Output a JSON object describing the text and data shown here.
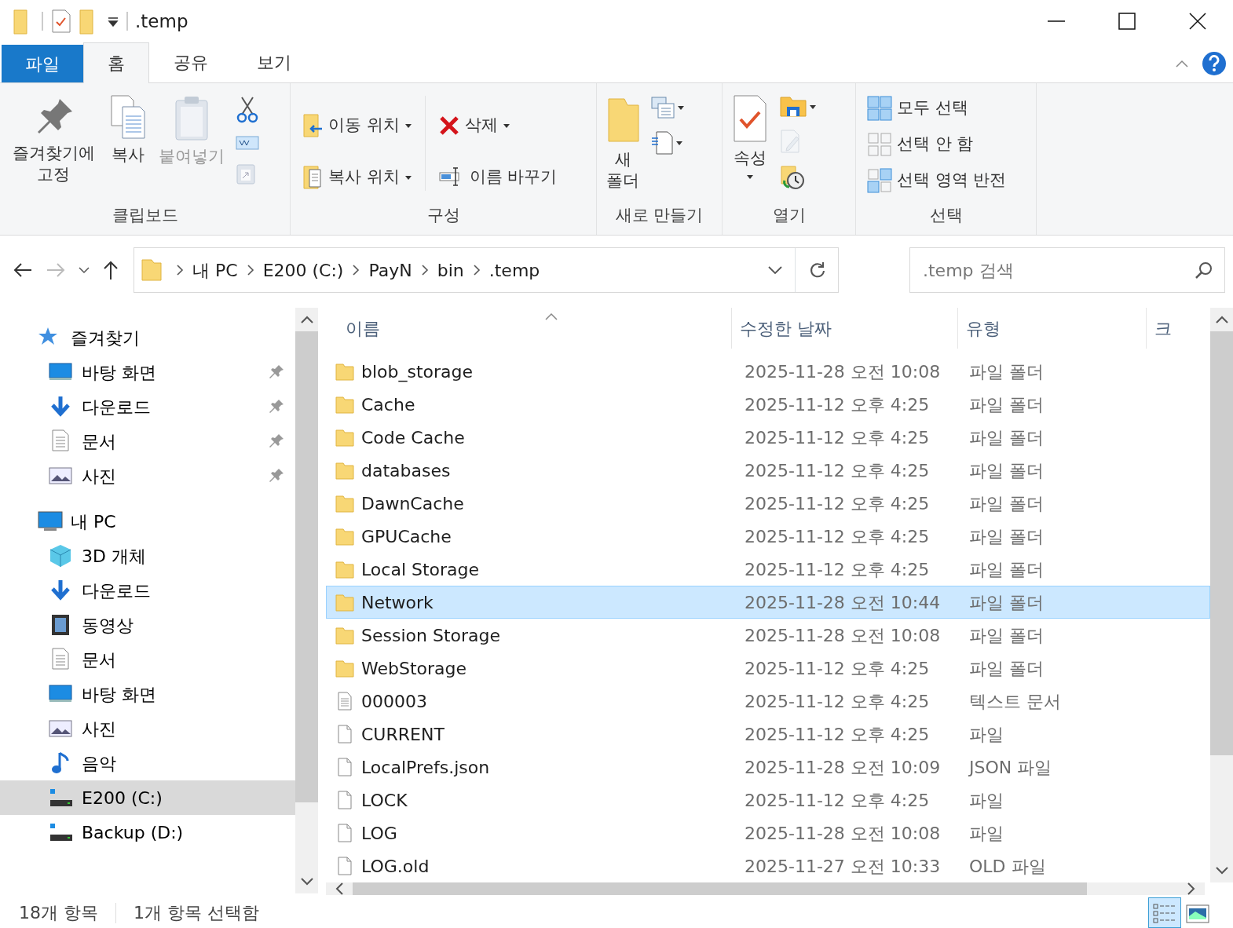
{
  "window": {
    "title": ".temp"
  },
  "ribbon": {
    "tabs": [
      {
        "label": "파일",
        "kind": "file",
        "selected": false
      },
      {
        "label": "홈",
        "kind": "tab",
        "selected": true
      },
      {
        "label": "공유",
        "kind": "tab",
        "selected": false
      },
      {
        "label": "보기",
        "kind": "tab",
        "selected": false
      }
    ],
    "groups": [
      {
        "label": "클립보드",
        "items": [
          {
            "kind": "large",
            "label": "즐겨찾기에 고정",
            "disabled": false,
            "dropdown": false
          },
          {
            "kind": "large",
            "label": "복사",
            "disabled": false,
            "dropdown": false
          },
          {
            "kind": "large",
            "label": "붙여넣기",
            "disabled": true,
            "dropdown": false
          },
          {
            "kind": "icon",
            "disabled": false,
            "dropdown": false
          },
          {
            "kind": "icon",
            "disabled": false,
            "dropdown": false
          },
          {
            "kind": "icon",
            "disabled": true,
            "dropdown": false
          }
        ]
      },
      {
        "label": "구성",
        "items": [
          {
            "kind": "small",
            "label": "이동 위치",
            "disabled": false,
            "dropdown": true
          },
          {
            "kind": "small",
            "label": "복사 위치",
            "disabled": false,
            "dropdown": true
          },
          {
            "kind": "small",
            "label": "삭제",
            "disabled": false,
            "dropdown": true
          },
          {
            "kind": "small",
            "label": "이름 바꾸기",
            "disabled": false,
            "dropdown": false
          }
        ]
      },
      {
        "label": "새로 만들기",
        "items": [
          {
            "kind": "large",
            "label": "새 폴더",
            "disabled": false,
            "dropdown": false
          },
          {
            "kind": "icon",
            "disabled": false,
            "dropdown": true
          },
          {
            "kind": "icon",
            "disabled": false,
            "dropdown": true
          }
        ]
      },
      {
        "label": "열기",
        "items": [
          {
            "kind": "large",
            "label": "속성",
            "disabled": false,
            "dropdown": true
          },
          {
            "kind": "icon",
            "disabled": false,
            "dropdown": true
          },
          {
            "kind": "icon",
            "disabled": true,
            "dropdown": false
          },
          {
            "kind": "icon",
            "disabled": false,
            "dropdown": false
          }
        ]
      },
      {
        "label": "선택",
        "items": [
          {
            "kind": "small",
            "label": "모두 선택",
            "disabled": false,
            "dropdown": false
          },
          {
            "kind": "small",
            "label": "선택 안 함",
            "disabled": false,
            "dropdown": false
          },
          {
            "kind": "small",
            "label": "선택 영역 반전",
            "disabled": false,
            "dropdown": false
          }
        ]
      }
    ]
  },
  "address": {
    "crumbs": [
      "내 PC",
      "E200 (C:)",
      "PayN",
      "bin",
      ".temp"
    ],
    "search_placeholder": ".temp 검색"
  },
  "sidebar": {
    "items": [
      {
        "label": "즐겨찾기",
        "kind": "star",
        "pinned": false,
        "selected": false,
        "children": [
          {
            "label": "바탕 화면",
            "kind": "desktop",
            "pinned": true,
            "selected": false
          },
          {
            "label": "다운로드",
            "kind": "download",
            "pinned": true,
            "selected": false
          },
          {
            "label": "문서",
            "kind": "document",
            "pinned": true,
            "selected": false
          },
          {
            "label": "사진",
            "kind": "picture",
            "pinned": true,
            "selected": false
          }
        ]
      },
      {
        "label": "내 PC",
        "kind": "pc",
        "pinned": false,
        "selected": false,
        "children": [
          {
            "label": "3D 개체",
            "kind": "cube",
            "pinned": false,
            "selected": false
          },
          {
            "label": "다운로드",
            "kind": "download",
            "pinned": false,
            "selected": false
          },
          {
            "label": "동영상",
            "kind": "video",
            "pinned": false,
            "selected": false
          },
          {
            "label": "문서",
            "kind": "document",
            "pinned": false,
            "selected": false
          },
          {
            "label": "바탕 화면",
            "kind": "desktop",
            "pinned": false,
            "selected": false
          },
          {
            "label": "사진",
            "kind": "picture",
            "pinned": false,
            "selected": false
          },
          {
            "label": "음악",
            "kind": "music",
            "pinned": false,
            "selected": false
          },
          {
            "label": "E200 (C:)",
            "kind": "drive",
            "pinned": false,
            "selected": true
          },
          {
            "label": "Backup (D:)",
            "kind": "drive",
            "pinned": false,
            "selected": false
          }
        ]
      }
    ]
  },
  "table": {
    "columns": [
      "이름",
      "수정한 날짜",
      "유형",
      "크"
    ],
    "rows": [
      {
        "name": "blob_storage",
        "date": "2025-11-28 오전 10:08",
        "type": "파일 폴더",
        "kind": "folder",
        "selected": false
      },
      {
        "name": "Cache",
        "date": "2025-11-12 오후 4:25",
        "type": "파일 폴더",
        "kind": "folder",
        "selected": false
      },
      {
        "name": "Code Cache",
        "date": "2025-11-12 오후 4:25",
        "type": "파일 폴더",
        "kind": "folder",
        "selected": false
      },
      {
        "name": "databases",
        "date": "2025-11-12 오후 4:25",
        "type": "파일 폴더",
        "kind": "folder",
        "selected": false
      },
      {
        "name": "DawnCache",
        "date": "2025-11-12 오후 4:25",
        "type": "파일 폴더",
        "kind": "folder",
        "selected": false
      },
      {
        "name": "GPUCache",
        "date": "2025-11-12 오후 4:25",
        "type": "파일 폴더",
        "kind": "folder",
        "selected": false
      },
      {
        "name": "Local Storage",
        "date": "2025-11-12 오후 4:25",
        "type": "파일 폴더",
        "kind": "folder",
        "selected": false
      },
      {
        "name": "Network",
        "date": "2025-11-28 오전 10:44",
        "type": "파일 폴더",
        "kind": "folder",
        "selected": true
      },
      {
        "name": "Session Storage",
        "date": "2025-11-28 오전 10:08",
        "type": "파일 폴더",
        "kind": "folder",
        "selected": false
      },
      {
        "name": "WebStorage",
        "date": "2025-11-12 오후 4:25",
        "type": "파일 폴더",
        "kind": "folder",
        "selected": false
      },
      {
        "name": "000003",
        "date": "2025-11-12 오후 4:25",
        "type": "텍스트 문서",
        "kind": "text",
        "selected": false
      },
      {
        "name": "CURRENT",
        "date": "2025-11-12 오후 4:25",
        "type": "파일",
        "kind": "file",
        "selected": false
      },
      {
        "name": "LocalPrefs.json",
        "date": "2025-11-28 오전 10:09",
        "type": "JSON 파일",
        "kind": "file",
        "selected": false
      },
      {
        "name": "LOCK",
        "date": "2025-11-12 오후 4:25",
        "type": "파일",
        "kind": "file",
        "selected": false
      },
      {
        "name": "LOG",
        "date": "2025-11-28 오전 10:08",
        "type": "파일",
        "kind": "file",
        "selected": false
      },
      {
        "name": "LOG.old",
        "date": "2025-11-27 오전 10:33",
        "type": "OLD 파일",
        "kind": "file",
        "selected": false
      }
    ]
  },
  "status_bar": {
    "count": "18개 항목",
    "selection": "1개 항목 선택함",
    "views": [
      {
        "kind": "details",
        "selected": true
      },
      {
        "kind": "large",
        "selected": false
      }
    ]
  }
}
